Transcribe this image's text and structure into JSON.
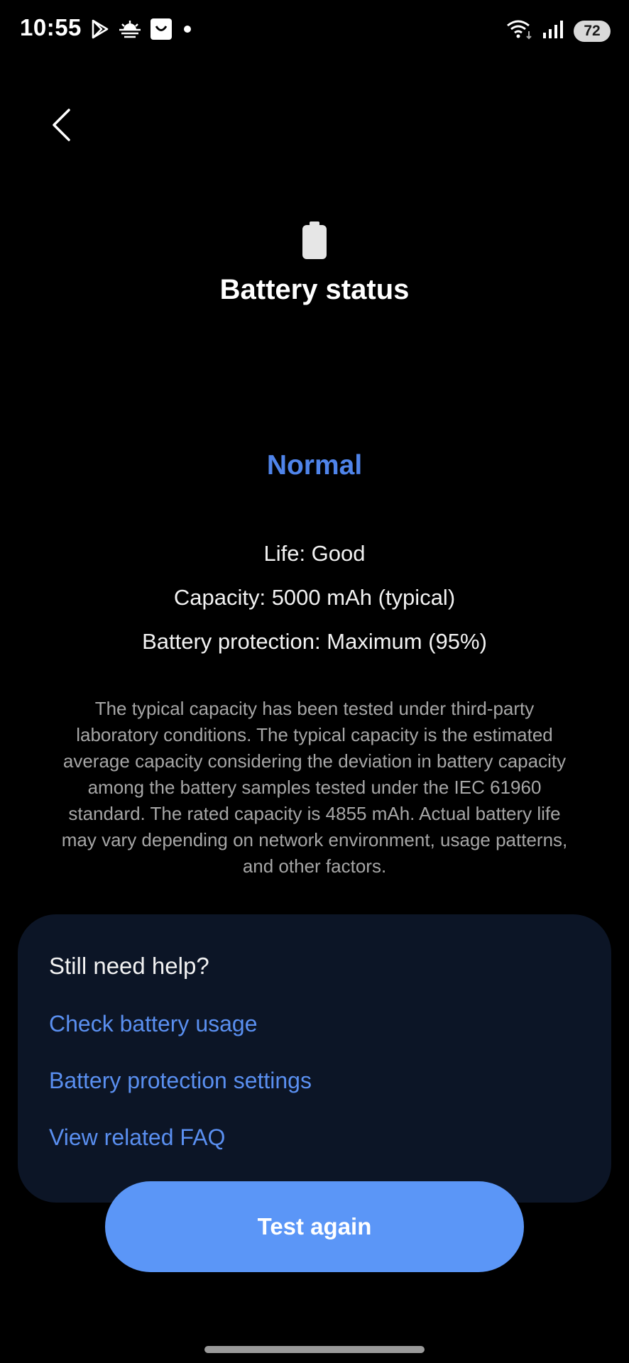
{
  "status_bar": {
    "time": "10:55",
    "battery_level": "72",
    "left_icons": [
      "play-store-icon",
      "weather-icon",
      "shopping-bag-icon",
      "notification-dot-icon"
    ],
    "right_icons": [
      "wifi-icon",
      "signal-icon",
      "battery-icon"
    ]
  },
  "header": {
    "title": "Battery status",
    "icon": "battery-icon"
  },
  "status": {
    "value": "Normal",
    "color": "#4f84ea"
  },
  "details": {
    "life": "Life: Good",
    "capacity": "Capacity: 5000 mAh (typical)",
    "protection": "Battery protection: Maximum (95%)"
  },
  "note": "The typical capacity has been tested under third-party laboratory conditions. The typical capacity is the estimated average capacity considering the deviation in battery capacity among the battery samples tested under the IEC 61960 standard. The rated capacity is 4855 mAh. Actual battery life may vary depending on network environment, usage patterns, and other factors.",
  "help": {
    "title": "Still need help?",
    "links": [
      "Check battery usage",
      "Battery protection settings",
      "View related FAQ"
    ],
    "link_color": "#5a8ff0"
  },
  "actions": {
    "test_again": "Test again",
    "button_color": "#5b96f7"
  }
}
